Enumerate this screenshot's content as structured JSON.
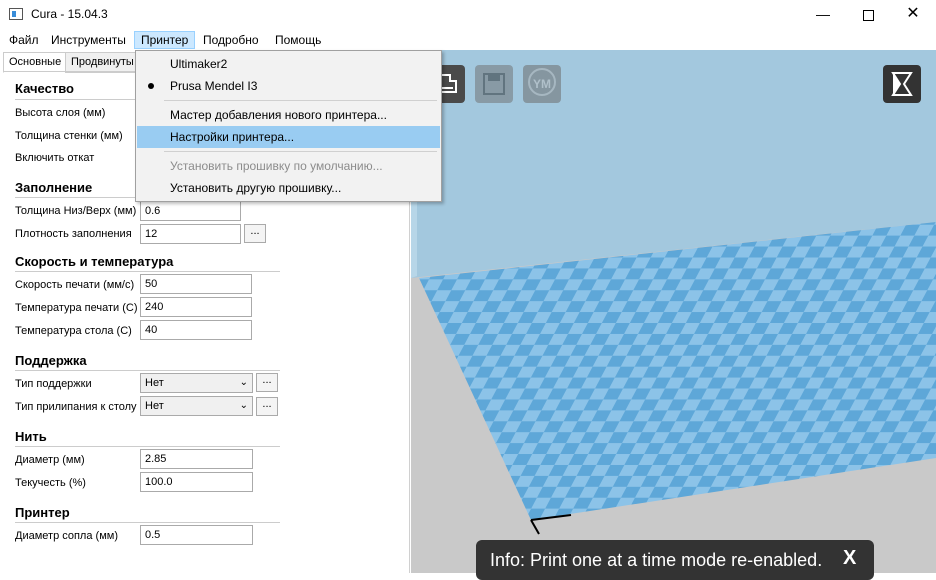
{
  "window": {
    "title": "Cura - 15.04.3",
    "minimize": "—",
    "close": "✕"
  },
  "menubar": [
    "Файл",
    "Инструменты",
    "Принтер",
    "Подробно",
    "Помощь"
  ],
  "tabs": {
    "basic": "Основные",
    "advanced": "Продвинуты"
  },
  "quality": {
    "header": "Качество",
    "layer_height_label": "Высота слоя (мм)",
    "shell_thickness_label": "Толщина стенки (мм)",
    "retraction_label": "Включить откат"
  },
  "fill": {
    "header": "Заполнение",
    "bottom_top_label": "Толщина Низ/Верх (мм)",
    "bottom_top_value": "0.6",
    "density_label": "Плотность заполнения",
    "density_value": "12",
    "dots": "..."
  },
  "speed": {
    "header": "Скорость и температура",
    "print_speed_label": "Скорость печати (мм/с)",
    "print_speed_value": "50",
    "print_temp_label": "Температура печати (С)",
    "print_temp_value": "240",
    "bed_temp_label": "Температура стола (С)",
    "bed_temp_value": "40"
  },
  "support": {
    "header": "Поддержка",
    "type_label": "Тип поддержки",
    "type_value": "Нет",
    "adhesion_label": "Тип прилипания к столу",
    "adhesion_value": "Нет",
    "dots": "..."
  },
  "filament": {
    "header": "Нить",
    "diameter_label": "Диаметр (мм)",
    "diameter_value": "2.85",
    "flow_label": "Текучесть (%)",
    "flow_value": "100.0"
  },
  "machine": {
    "header": "Принтер",
    "nozzle_label": "Диаметр сопла (мм)",
    "nozzle_value": "0.5"
  },
  "printer_menu": {
    "printers": [
      "Ultimaker2",
      "Prusa Mendel I3"
    ],
    "add_printer": "Мастер добавления нового принтера...",
    "printer_settings": "Настройки принтера...",
    "default_firmware": "Установить прошивку по умолчанию...",
    "other_firmware": "Установить другую прошивку..."
  },
  "toolbar": {
    "ym_label": "YM"
  },
  "info": {
    "message": "Info: Print one at a time mode re-enabled.",
    "close": "X"
  },
  "colors": {
    "bed_light": "#8cc3e8",
    "bed_dark": "#5ea7d8",
    "wall": "#a3c8de",
    "floor": "#c9c9c9",
    "menu_highlight": "#99ccf2"
  }
}
